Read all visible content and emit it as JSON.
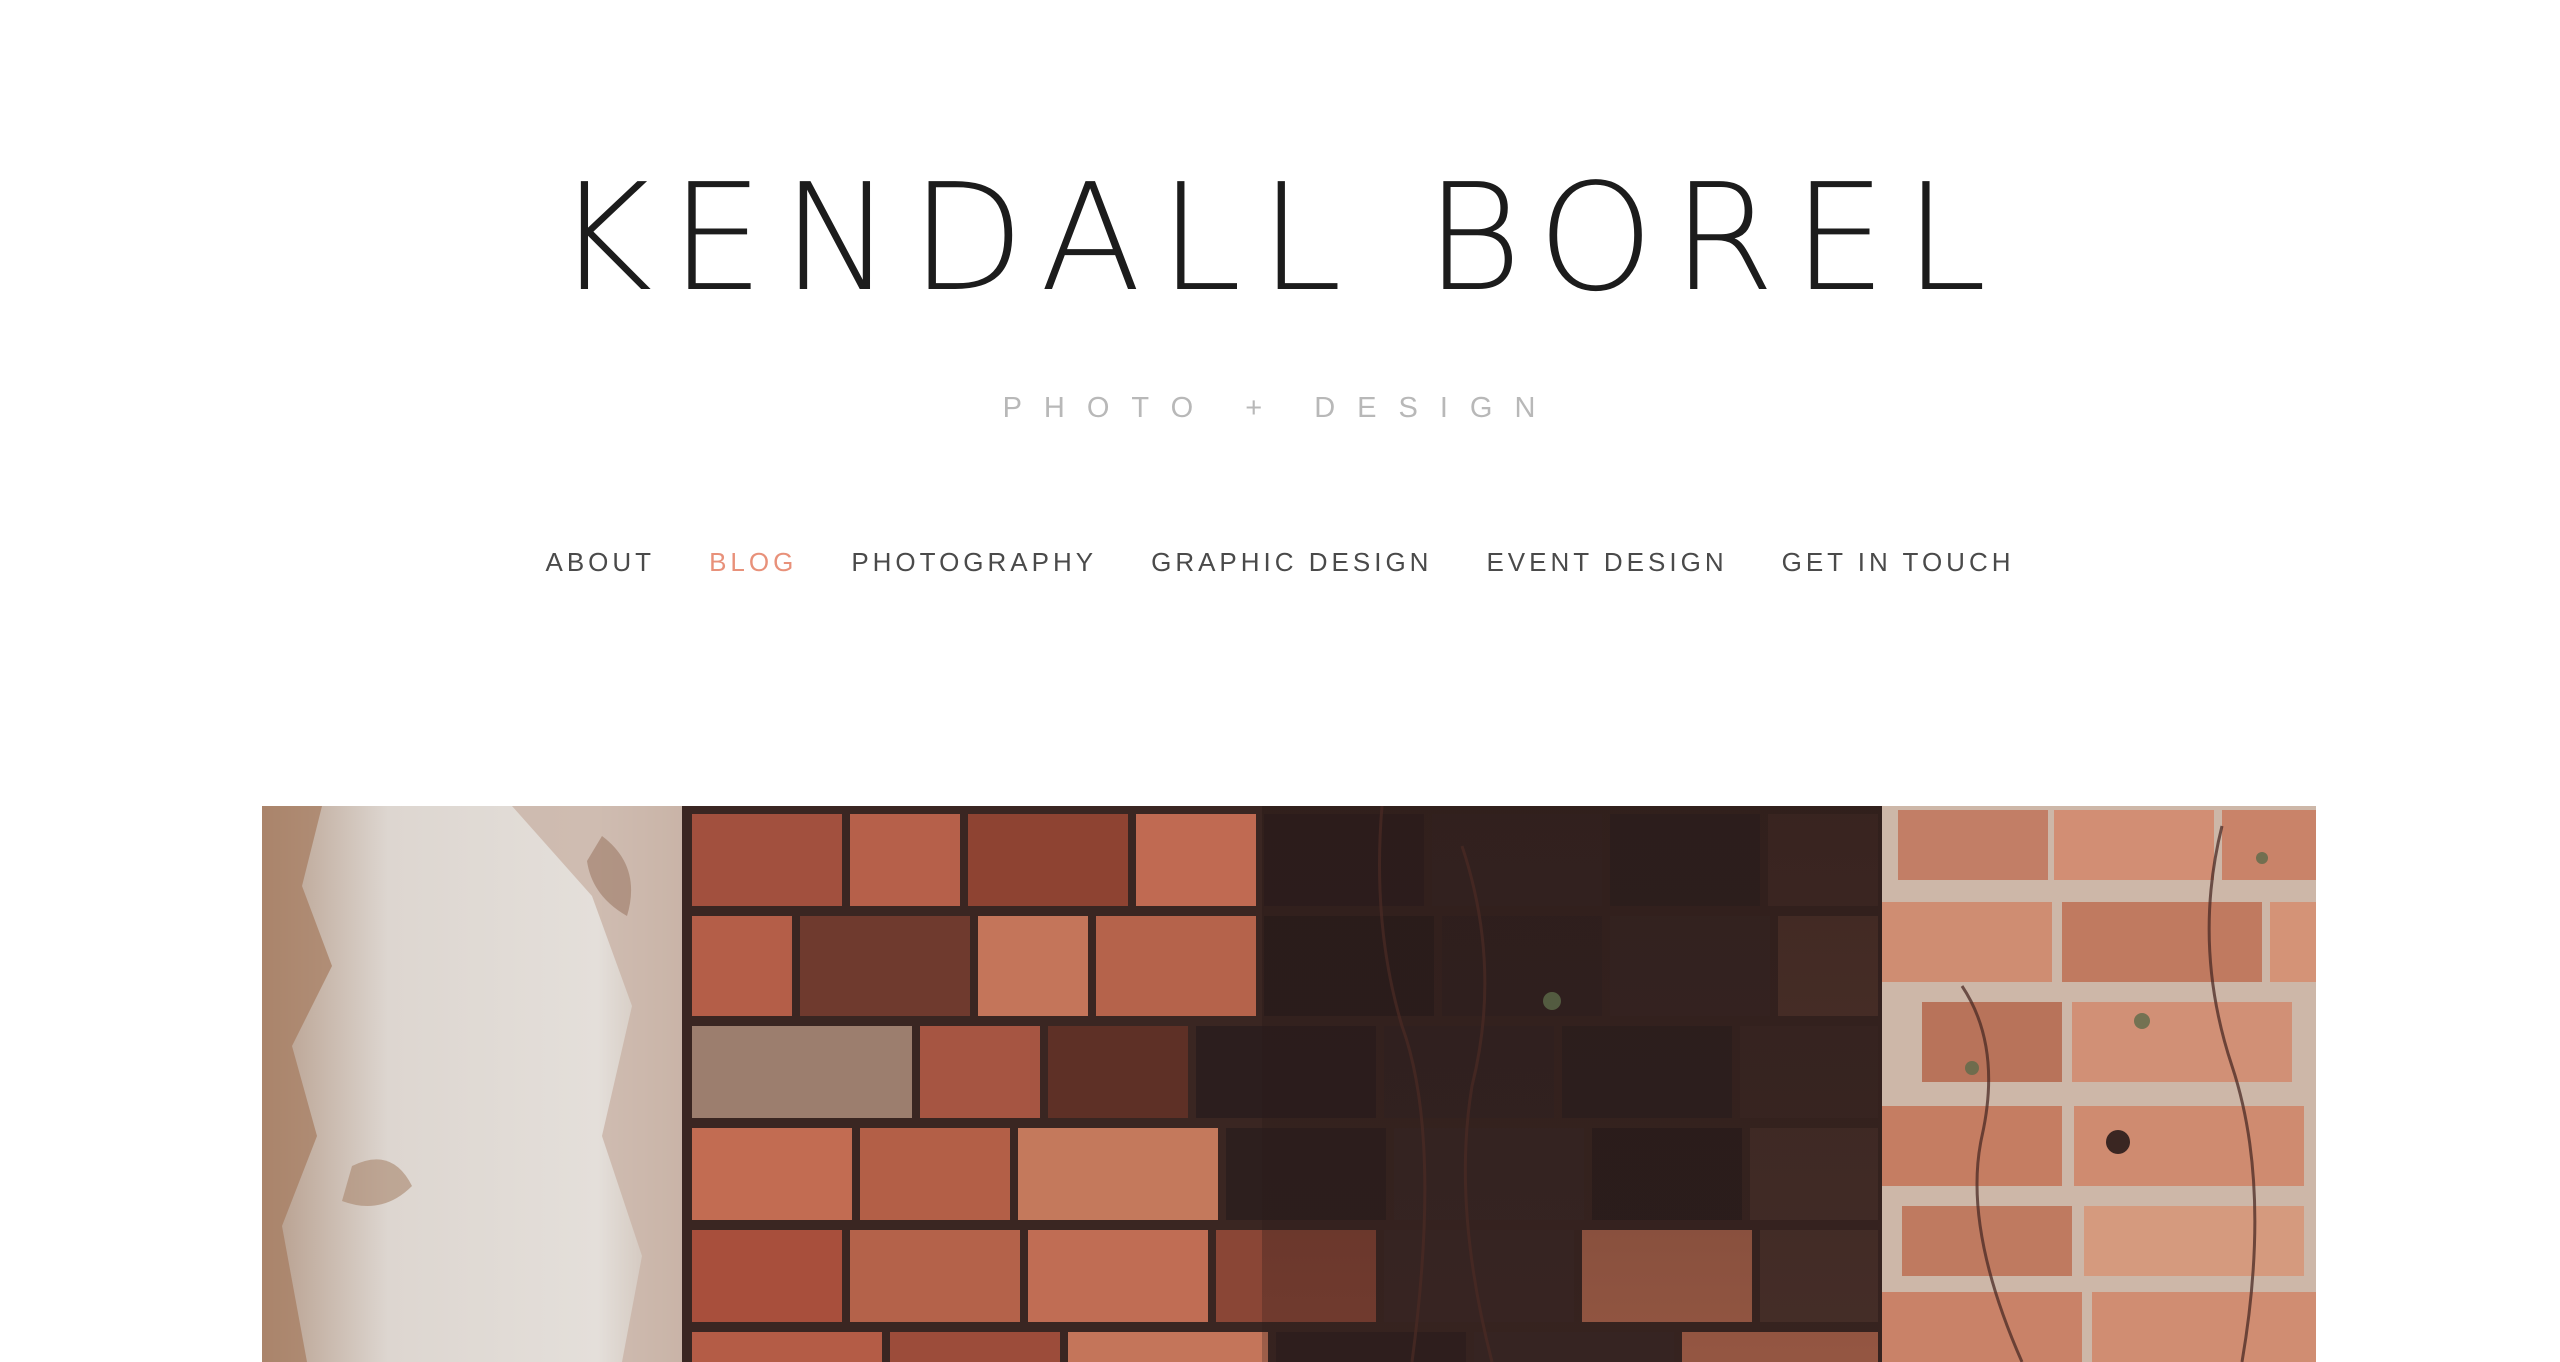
{
  "site": {
    "title": "KENDALL BOREL",
    "tagline": "PHOTO + DESIGN"
  },
  "nav": {
    "items": [
      {
        "label": "ABOUT",
        "active": false
      },
      {
        "label": "BLOG",
        "active": true
      },
      {
        "label": "PHOTOGRAPHY",
        "active": false
      },
      {
        "label": "GRAPHIC DESIGN",
        "active": false
      },
      {
        "label": "EVENT DESIGN",
        "active": false
      },
      {
        "label": "GET IN TOUCH",
        "active": false
      }
    ]
  },
  "colors": {
    "title": "#1c1c1c",
    "tagline": "#b8b8b8",
    "nav": "#4a4a4a",
    "nav_active": "#e8917a",
    "background": "#ffffff"
  },
  "hero": {
    "subject": "weathered brick wall photograph"
  }
}
